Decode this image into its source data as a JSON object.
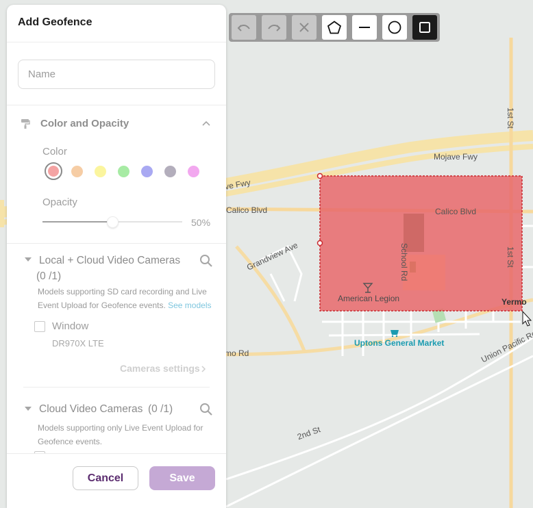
{
  "panel": {
    "title": "Add Geofence",
    "name_placeholder": "Name",
    "color_section": {
      "title": "Color and Opacity",
      "color_label": "Color",
      "colors": [
        "#f4a3a3",
        "#f6cda5",
        "#fbf59e",
        "#a7eba4",
        "#a9a9f2",
        "#b3aebc",
        "#f2a8ef"
      ],
      "selected_color_index": 0,
      "opacity_label": "Opacity",
      "opacity_value": "50%",
      "opacity_fraction": 0.5
    },
    "local_cloud": {
      "title": "Local + Cloud Video Cameras",
      "count": "(0 /1)",
      "description": "Models supporting SD card recording and Live Event Upload for Geofence events.",
      "see_models": "See models",
      "camera_name": "Window",
      "camera_model": "DR970X LTE",
      "settings_label": "Cameras settings"
    },
    "cloud_only": {
      "title": "Cloud Video Cameras",
      "count": "(0 /1)",
      "description": "Models supporting only Live Event Upload for Geofence events."
    },
    "footer": {
      "cancel": "Cancel",
      "save": "Save"
    }
  },
  "toolbar": {
    "tools": [
      "undo-icon",
      "redo-icon",
      "close-icon",
      "pentagon-icon",
      "line-icon",
      "circle-icon",
      "square-icon"
    ],
    "active_tool": "square-icon"
  },
  "map": {
    "labels": {
      "mojave": "Mojave Fwy",
      "calico_blvd_left": "Calico Blvd",
      "calico_blvd_right": "Calico Blvd",
      "fwy_left": "ve Fwy",
      "grandview": "Grandview Ave",
      "school_rd": "School Rd",
      "first_st_top": "1st St",
      "first_st_right": "1st St",
      "american_legion": "American Legion",
      "yermo": "Yermo",
      "uptons": "Uptons General Market",
      "mo_rd": "mo Rd",
      "union_pacific": "Union Pacific Rd",
      "second_st": "2nd St"
    },
    "geofence_color": "#e8696b"
  }
}
